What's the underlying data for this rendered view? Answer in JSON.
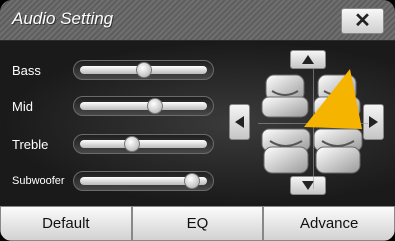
{
  "window": {
    "title": "Audio Setting",
    "close_symbol": "✕"
  },
  "sliders": [
    {
      "label": "Bass",
      "level": 0.5
    },
    {
      "label": "Mid",
      "level": 0.6
    },
    {
      "label": "Treble",
      "level": 0.4
    },
    {
      "label": "Subwoofer",
      "level": 0.92
    }
  ],
  "balance": {
    "up_icon": "triangle-up-icon",
    "down_icon": "triangle-down-icon",
    "left_icon": "triangle-left-icon",
    "right_icon": "triangle-right-icon",
    "pointer_color": "#f4b400"
  },
  "bottom_buttons": {
    "default": "Default",
    "eq": "EQ",
    "advance": "Advance"
  },
  "colors": {
    "title_bar": "#666666",
    "button_face": "#e8e8e8",
    "background": "#1b1b1b"
  }
}
